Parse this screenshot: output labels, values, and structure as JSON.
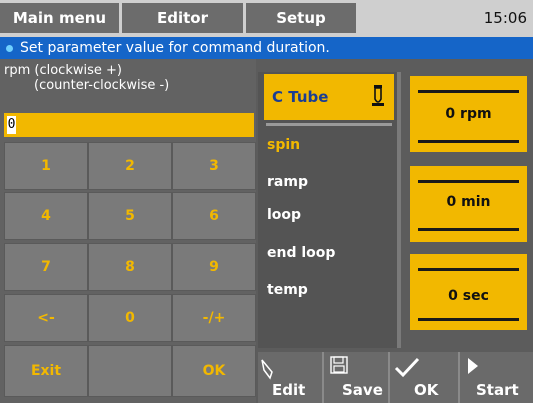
{
  "menu": {
    "tabs": [
      {
        "label": "Main menu"
      },
      {
        "label": "Editor"
      },
      {
        "label": "Setup"
      }
    ],
    "clock": "15:06"
  },
  "info": {
    "text": "Set parameter value for command duration."
  },
  "param": {
    "label_line1": "rpm (clockwise +)",
    "label_line2": "(counter-clockwise -)",
    "value": "0"
  },
  "keypad": {
    "keys": [
      "1",
      "2",
      "3",
      "4",
      "5",
      "6",
      "7",
      "8",
      "9",
      "<-",
      "0",
      "-/+",
      "Exit",
      "",
      "OK"
    ]
  },
  "program": {
    "name": "C Tube",
    "commands": [
      "spin",
      "ramp",
      "loop",
      "end loop",
      "temp"
    ],
    "active_command": "spin"
  },
  "values": {
    "speed": "0 rpm",
    "duration_min": "0 min",
    "duration_sec": "0 sec"
  },
  "toolbar": {
    "edit": "Edit",
    "save": "Save",
    "ok": "OK",
    "start": "Start"
  },
  "colors": {
    "accent": "#f2b800",
    "info_bar": "#1565c8",
    "text_blue": "#1b3e93"
  }
}
